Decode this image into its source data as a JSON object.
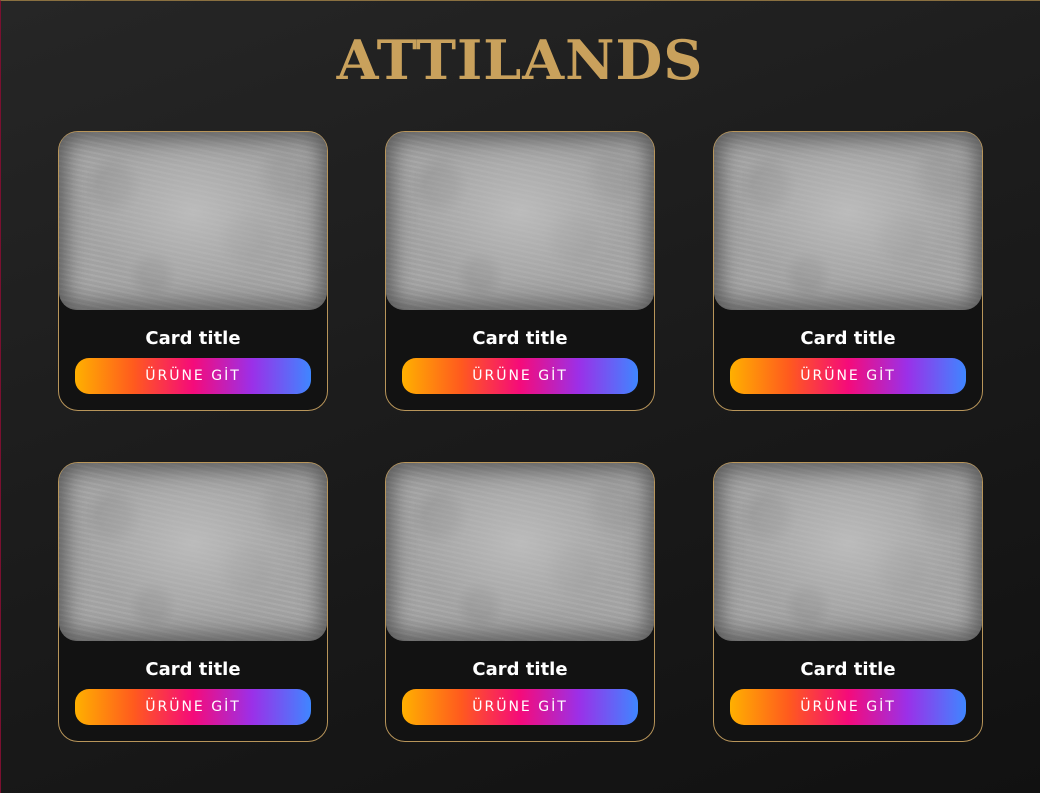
{
  "page": {
    "brand": "ATTILANDS",
    "colors": {
      "brand_gold": "#c9a15c",
      "card_border": "#b8955a",
      "button_gradient": [
        "#ffb000",
        "#ff5a1e",
        "#f50b7a",
        "#9b30e8",
        "#3f86ff"
      ]
    }
  },
  "cards": [
    {
      "image": "concrete-texture",
      "title": "Card title",
      "button_label": "ÜRÜNE GİT"
    },
    {
      "image": "concrete-texture",
      "title": "Card title",
      "button_label": "ÜRÜNE GİT"
    },
    {
      "image": "concrete-texture",
      "title": "Card title",
      "button_label": "ÜRÜNE GİT"
    },
    {
      "image": "concrete-texture",
      "title": "Card title",
      "button_label": "ÜRÜNE GİT"
    },
    {
      "image": "concrete-texture",
      "title": "Card title",
      "button_label": "ÜRÜNE GİT"
    },
    {
      "image": "concrete-texture",
      "title": "Card title",
      "button_label": "ÜRÜNE GİT"
    }
  ]
}
